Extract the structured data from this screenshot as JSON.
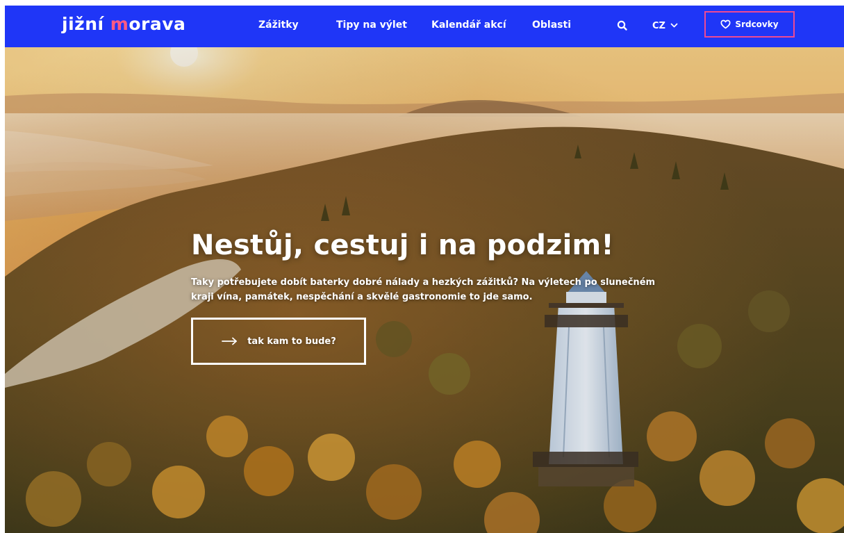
{
  "header": {
    "logo": {
      "part1": "jižní ",
      "accent_letter": "m",
      "part2": "orava"
    },
    "nav": [
      {
        "label": "Zážitky"
      },
      {
        "label": "Tipy na výlet"
      },
      {
        "label": "Kalendář akcí"
      },
      {
        "label": "Oblasti"
      }
    ],
    "search_icon": "search-icon",
    "language": {
      "value": "CZ",
      "icon": "chevron-down-icon"
    },
    "favorites": {
      "label": "Srdcovky",
      "icon": "heart-icon"
    }
  },
  "hero": {
    "title": "Nestůj, cestuj i na podzim!",
    "text": "Taky potřebujete dobít baterky dobré nálady a hezkých zážitků? Na výletech po slunečném kraji vína, památek, nespěchání a skvělé gastronomie to jde samo.",
    "cta": {
      "label": "tak kam to bude?",
      "icon": "arrow-right-icon"
    },
    "background": "autumn-forest-lookout-tower-photo"
  },
  "colors": {
    "brand_blue": "#1f36f7",
    "logo_accent": "#ff5a83",
    "highlight_border": "#ee4a93",
    "text": "#ffffff"
  }
}
